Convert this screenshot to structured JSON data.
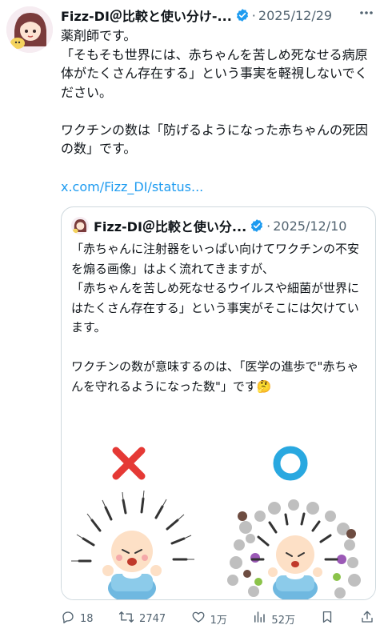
{
  "author": {
    "name": "Fizz-DI＠比較と使い分け-...",
    "separator": "·",
    "date": "2025/12/29",
    "more_icon": "ellipsis-icon"
  },
  "tweet": {
    "text": "薬剤師です。\n「そもそも世界には、赤ちゃんを苦しめ死なせる病原体がたくさん存在する」という事実を軽視しないでください。\n\nワクチンの数は「防げるようになった赤ちゃんの死因の数」です。",
    "link": "x.com/Fizz_DI/status..."
  },
  "quote": {
    "name": "Fizz-DI＠比較と使い分...",
    "separator": "·",
    "date": "2025/12/10",
    "text": "「赤ちゃんに注射器をいっぱい向けてワクチンの不安を煽る画像」はよく流れてきますが、\n「赤ちゃんを苦しめ死なせるウイルスや細菌が世界にはたくさん存在する」という事実がそこには欠けています。\n\nワクチンの数が意味するのは、「医学の進歩で\"赤ちゃんを守れるようになった数\"」です🤔"
  },
  "actions": {
    "reply": "18",
    "retweet": "2747",
    "like": "1万",
    "views": "52万"
  },
  "colors": {
    "accent": "#1d9bf0",
    "secondary_text": "#536471",
    "border": "#cfd9de",
    "cross_red": "#e53935",
    "circle_blue": "#29a8e0"
  }
}
